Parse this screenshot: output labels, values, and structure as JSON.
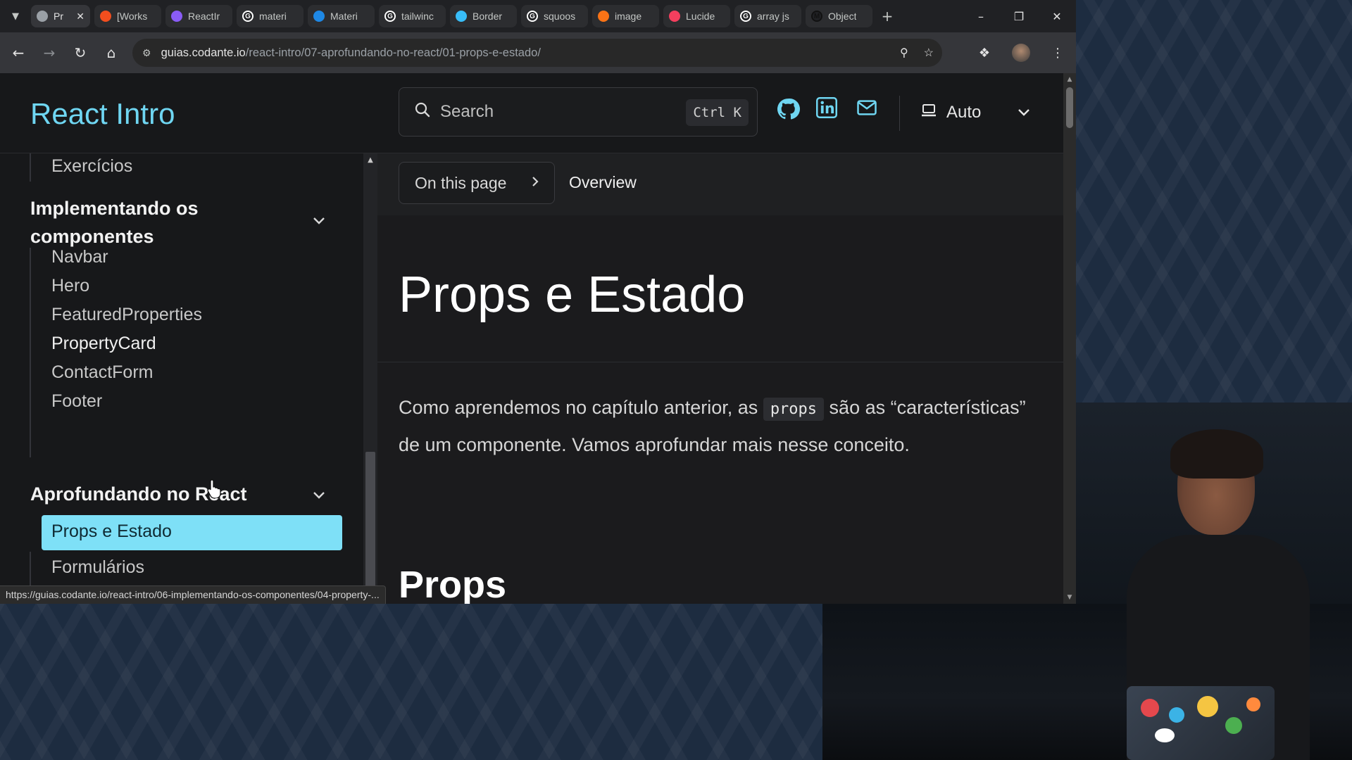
{
  "browser": {
    "tabs": [
      {
        "label": "Pr",
        "active": true,
        "favicon_color": "#9aa0a6",
        "favicon_glyph": ""
      },
      {
        "label": "[Works",
        "favicon_color": "#f24e1e",
        "favicon_glyph": ""
      },
      {
        "label": "ReactIr",
        "favicon_color": "#8a5cf6",
        "favicon_glyph": ""
      },
      {
        "label": "materi",
        "favicon_color": "#ffffff",
        "favicon_glyph": "G"
      },
      {
        "label": "Materi",
        "favicon_color": "#1e88e5",
        "favicon_glyph": ""
      },
      {
        "label": "tailwinc",
        "favicon_color": "#ffffff",
        "favicon_glyph": "G"
      },
      {
        "label": "Border",
        "favicon_color": "#38bdf8",
        "favicon_glyph": ""
      },
      {
        "label": "squoos",
        "favicon_color": "#ffffff",
        "favicon_glyph": "G"
      },
      {
        "label": "image",
        "favicon_color": "#f97316",
        "favicon_glyph": ""
      },
      {
        "label": "Lucide",
        "favicon_color": "#f43f5e",
        "favicon_glyph": ""
      },
      {
        "label": "array js",
        "favicon_color": "#ffffff",
        "favicon_glyph": "G"
      },
      {
        "label": "Object",
        "favicon_color": "#111111",
        "favicon_glyph": "M"
      }
    ],
    "url_host": "guias.codante.io",
    "url_path": "/react-intro/07-aprofundando-no-react/01-props-e-estado/",
    "status_url": "https://guias.codante.io/react-intro/06-implementando-os-componentes/04-property-..."
  },
  "site": {
    "title": "React Intro",
    "accent_color": "#6fd6f2",
    "search_placeholder": "Search",
    "search_shortcut": "Ctrl K",
    "social_icons": [
      "github-icon",
      "linkedin-icon",
      "mail-icon"
    ],
    "theme_label": "Auto"
  },
  "sidebar": {
    "top_item": "Exercícios",
    "group1_title": "Implementando os componentes",
    "group1_items": [
      "Navbar",
      "Hero",
      "FeaturedProperties",
      "PropertyCard",
      "ContactForm",
      "Footer"
    ],
    "group2_title": "Aprofundando no React",
    "active_item": "Props e Estado",
    "group2_next_item": "Formulários"
  },
  "main": {
    "toc_label": "On this page",
    "toc_current": "Overview",
    "heading": "Props e Estado",
    "para_before_code": "Como aprendemos no capítulo anterior, as ",
    "para_code": "props",
    "para_after_code": " são as “características” de um componente. Vamos aprofundar mais nesse conceito.",
    "subheading": "Props"
  }
}
